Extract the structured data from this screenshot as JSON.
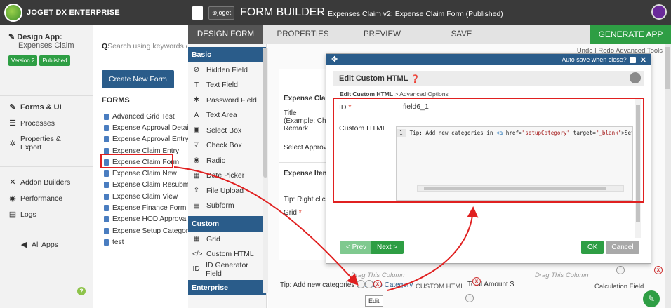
{
  "app": {
    "brand": "JOGET DX ENTERPRISE"
  },
  "sidebar": {
    "design_app": "Design App:",
    "app_name": "Expenses Claim",
    "version_badge": "Version 2",
    "status_badge": "Published",
    "items": [
      {
        "label": "Forms & UI",
        "icon": "edit-icon"
      },
      {
        "label": "Processes",
        "icon": "list-icon"
      },
      {
        "label": "Properties & Export",
        "icon": "gear-icon"
      },
      {
        "label": "Addon Builders",
        "icon": "tools-icon"
      },
      {
        "label": "Performance",
        "icon": "dashboard-icon"
      },
      {
        "label": "Logs",
        "icon": "log-icon"
      },
      {
        "label": "All Apps",
        "icon": "back-circle-icon"
      }
    ]
  },
  "forms_panel": {
    "search_placeholder": "Search using keywords or #tag",
    "create_button": "Create New Form",
    "heading": "FORMS",
    "forms": [
      "Advanced Grid Test",
      "Expense Approval Detail",
      "Expense Approval Entry",
      "Expense Claim Entry",
      "Expense Claim Form",
      "Expense Claim New",
      "Expense Claim Resubmit",
      "Expense Claim View",
      "Expense Finance Form",
      "Expense HOD Approval Form",
      "Expense Setup Category",
      "test"
    ]
  },
  "builder": {
    "logo_text": "joget",
    "title": "FORM BUILDER",
    "subtitle": "Expenses Claim v2: Expense Claim Form (Published)",
    "tabs": [
      "DESIGN FORM",
      "PROPERTIES",
      "PREVIEW",
      "SAVE"
    ],
    "generate_button": "GENERATE APP",
    "undo_bar": "Undo | Redo   Advanced Tools"
  },
  "palette": {
    "basic_header": "Basic",
    "basic_items": [
      {
        "label": "Hidden Field",
        "icon": "hidden-icon"
      },
      {
        "label": "Text Field",
        "icon": "textfield-icon"
      },
      {
        "label": "Password Field",
        "icon": "asterisk-icon"
      },
      {
        "label": "Text Area",
        "icon": "textarea-icon"
      },
      {
        "label": "Select Box",
        "icon": "selectbox-icon"
      },
      {
        "label": "Check Box",
        "icon": "checkbox-icon"
      },
      {
        "label": "Radio",
        "icon": "radio-icon"
      },
      {
        "label": "Date Picker",
        "icon": "calendar-icon"
      },
      {
        "label": "File Upload",
        "icon": "upload-icon"
      },
      {
        "label": "Subform",
        "icon": "subform-icon"
      }
    ],
    "custom_header": "Custom",
    "custom_items": [
      {
        "label": "Grid",
        "icon": "grid-icon"
      },
      {
        "label": "Custom HTML",
        "icon": "code-icon"
      },
      {
        "label": "ID Generator Field",
        "icon": "id-icon"
      }
    ],
    "enterprise_header": "Enterprise"
  },
  "canvas": {
    "section_title": "Expense Claim",
    "title_label": "Title",
    "title_hint": "(Example: China",
    "remark_label": "Remark",
    "approver_label": "Select Approver",
    "items_title": "Expense Items",
    "tip_right_click": "Tip: Right click m",
    "grid_label": "Grid",
    "drag_col_1": "Drag This Column",
    "drag_col_2": "Drag This Column",
    "tip_text": "Tip: Add new categories in",
    "tip_link": "Setup Category",
    "custom_html_label": "CUSTOM HTML",
    "total_amount": "Total Amount $",
    "calc_field": "Calculation Field",
    "tooltip": "Edit"
  },
  "modal": {
    "auto_save": "Auto save when close?",
    "title": "Edit Custom HTML",
    "breadcrumb_current": "Edit Custom HTML",
    "breadcrumb_next": "> Advanced Options",
    "id_label": "ID",
    "id_value": "field6_1",
    "html_label": "Custom HTML",
    "code_line_no": "1",
    "code_text_1": "Tip: Add new categories in ",
    "code_tag": "<a",
    "code_attr": " href=",
    "code_str_1": "\"setupCategory\"",
    "code_attr2": " target=",
    "code_str_2": "\"_blank\"",
    "code_tail": ">Setup C",
    "prev": "< Prev",
    "next": "Next >",
    "ok": "OK",
    "cancel": "Cancel"
  },
  "colors": {
    "header_dark": "#3a3a3a",
    "accent_blue": "#2a5c8a",
    "accent_green": "#2e9e44",
    "annotation_red": "#e02020"
  }
}
